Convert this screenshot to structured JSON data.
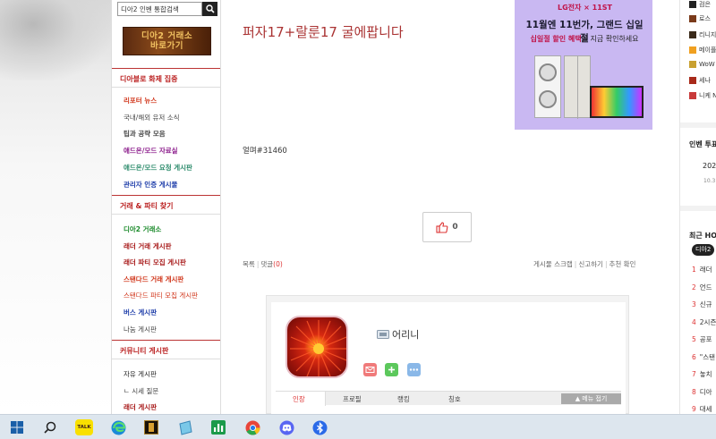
{
  "sidebar": {
    "search_placeholder": "디아2 인벤 통합검색",
    "banner_text": "디아2 거래소\n바로가기",
    "sections": [
      {
        "title": "디아블로 화제 집중",
        "items": [
          {
            "label": "리포터 뉴스",
            "color": "#d0351a",
            "bold": true
          },
          {
            "label": "국내/해외 유저 소식",
            "color": "#444444",
            "bold": false
          },
          {
            "label": "팁과 공략 모음",
            "color": "#444444",
            "bold": true
          },
          {
            "label": "애드온/모드 자료실",
            "color": "#8a1a8a",
            "bold": true
          },
          {
            "label": "애드온/모드 요청 게시판",
            "color": "#2a8a6a",
            "bold": true
          },
          {
            "label": "관리자 인증 게시물",
            "color": "#1a3aa8",
            "bold": true
          }
        ]
      },
      {
        "title": "거래 & 파티 찾기",
        "items": [
          {
            "label": "디아2 거래소",
            "color": "#1a8a2a",
            "bold": true
          },
          {
            "label": "래더 거래 게시판",
            "color": "#a81a1a",
            "bold": true
          },
          {
            "label": "래더 파티 모집 게시판",
            "color": "#a81a1a",
            "bold": true
          },
          {
            "label": "스탠다드 거래 게시판",
            "color": "#d0351a",
            "bold": true
          },
          {
            "label": "스탠다드 파티 모집 게시판",
            "color": "#d0351a",
            "bold": false
          },
          {
            "label": "버스 게시판",
            "color": "#1a3aa8",
            "bold": true
          },
          {
            "label": "나눔 게시판",
            "color": "#444444",
            "bold": false
          }
        ]
      },
      {
        "title": "커뮤니티 게시판",
        "items": [
          {
            "label": "자유 게시판",
            "color": "#222222",
            "bold": false
          },
          {
            "label": "ㄴ 시세 질문",
            "color": "#444444",
            "bold": false
          },
          {
            "label": "래더 게시판",
            "color": "#a81a1a",
            "bold": true
          }
        ]
      }
    ]
  },
  "post": {
    "title": "퍼자17+랄룬17 굴에팝니다",
    "body": "얼며#31460",
    "like_count": "0",
    "links_left": [
      "목록",
      "댓글"
    ],
    "comment_count": "(0)",
    "links_right": [
      "게시물 스크랩",
      "신고하기",
      "추천 확인"
    ]
  },
  "ad": {
    "logo": "LG전자 × 11ST",
    "headline": "11월엔 11번가, 그랜드 십일절",
    "sub_highlight": "십일절 할인 혜택",
    "sub_rest": "을 지금 확인하세요"
  },
  "profile": {
    "username": "어리니",
    "tabs": [
      "인장",
      "프로필",
      "랭킹",
      "칭호"
    ],
    "fold_button": "▲ 메뉴 접기"
  },
  "right_sidebar": {
    "top_items": [
      "검은",
      "로스",
      "리니지",
      "메이플",
      "WoW",
      "세나",
      "니케 N"
    ],
    "vote_header": "인벤 투표",
    "vote_year": "202",
    "vote_date": "10.3",
    "hot_header": "최근 HO",
    "hot_tag": "디아2",
    "hot_list": [
      {
        "rank": "1",
        "text": "래더"
      },
      {
        "rank": "2",
        "text": "언드"
      },
      {
        "rank": "3",
        "text": "신규"
      },
      {
        "rank": "4",
        "text": "2시즌"
      },
      {
        "rank": "5",
        "text": "공포"
      },
      {
        "rank": "6",
        "text": "\"스탠"
      },
      {
        "rank": "7",
        "text": "놓치"
      },
      {
        "rank": "8",
        "text": "디아"
      },
      {
        "rank": "9",
        "text": "대세"
      }
    ]
  },
  "taskbar": {
    "icons": [
      "windows-start-icon",
      "search-icon",
      "kakaotalk-icon",
      "edge-icon",
      "diablo-icon",
      "notes-icon",
      "spreadsheet-icon",
      "chrome-icon",
      "discord-icon",
      "bluetooth-icon"
    ],
    "kakaotalk_label": "TALK"
  },
  "colors": {
    "accent": "#b22222",
    "title": "#a33333",
    "ad_bg": "#c9b8f2"
  }
}
